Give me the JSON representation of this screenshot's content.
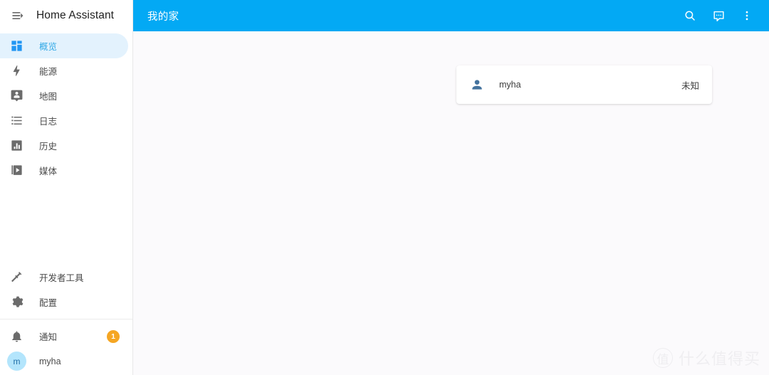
{
  "app": {
    "title": "Home Assistant",
    "menu_icon": "menu-open-icon"
  },
  "sidebar": {
    "items": [
      {
        "label": "概览",
        "icon": "view-dashboard-icon",
        "active": true
      },
      {
        "label": "能源",
        "icon": "lightning-bolt-icon",
        "active": false
      },
      {
        "label": "地图",
        "icon": "account-badge-icon",
        "active": false
      },
      {
        "label": "日志",
        "icon": "format-list-bulleted-icon",
        "active": false
      },
      {
        "label": "历史",
        "icon": "chart-box-icon",
        "active": false
      },
      {
        "label": "媒体",
        "icon": "play-box-multiple-icon",
        "active": false
      }
    ],
    "bottom_items": [
      {
        "label": "开发者工具",
        "icon": "hammer-icon"
      },
      {
        "label": "配置",
        "icon": "cog-icon"
      }
    ],
    "notifications": {
      "label": "通知",
      "icon": "bell-icon",
      "badge": "1",
      "badge_color": "#f5a623"
    },
    "user": {
      "label": "myha",
      "avatar_initial": "m",
      "avatar_color": "#b3e5fc"
    }
  },
  "topbar": {
    "title": "我的家",
    "accent_color": "#03a9f4",
    "actions": [
      {
        "name": "search-icon"
      },
      {
        "name": "assist-icon"
      },
      {
        "name": "overflow-menu-icon"
      }
    ]
  },
  "main": {
    "card": {
      "rows": [
        {
          "icon": "account-icon",
          "name": "myha",
          "state": "未知"
        }
      ]
    }
  },
  "watermark": {
    "mark": "值",
    "text": "什么值得买"
  }
}
